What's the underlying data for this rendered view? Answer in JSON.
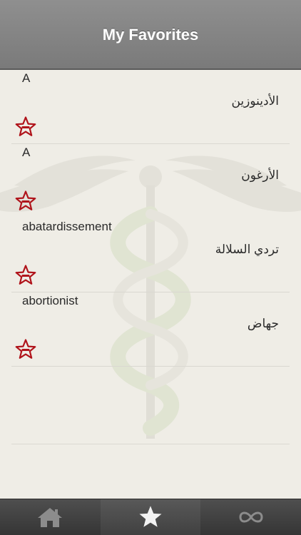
{
  "header": {
    "title": "My Favorites"
  },
  "favorites": [
    {
      "term": "A",
      "translation": "الأدينوزين"
    },
    {
      "term": "A",
      "translation": "الأرغون"
    },
    {
      "term": "abatardissement",
      "translation": "تردي السلالة"
    },
    {
      "term": "abortionist",
      "translation": "جهاض"
    }
  ],
  "tabbar": {
    "items": [
      {
        "icon": "home-icon",
        "active": false
      },
      {
        "icon": "star-icon",
        "active": true
      },
      {
        "icon": "infinity-icon",
        "active": false
      }
    ]
  },
  "colors": {
    "header": "#7a7a7a",
    "background": "#efede6",
    "accent_star": "#b0141b",
    "tabbar": "#353535"
  }
}
